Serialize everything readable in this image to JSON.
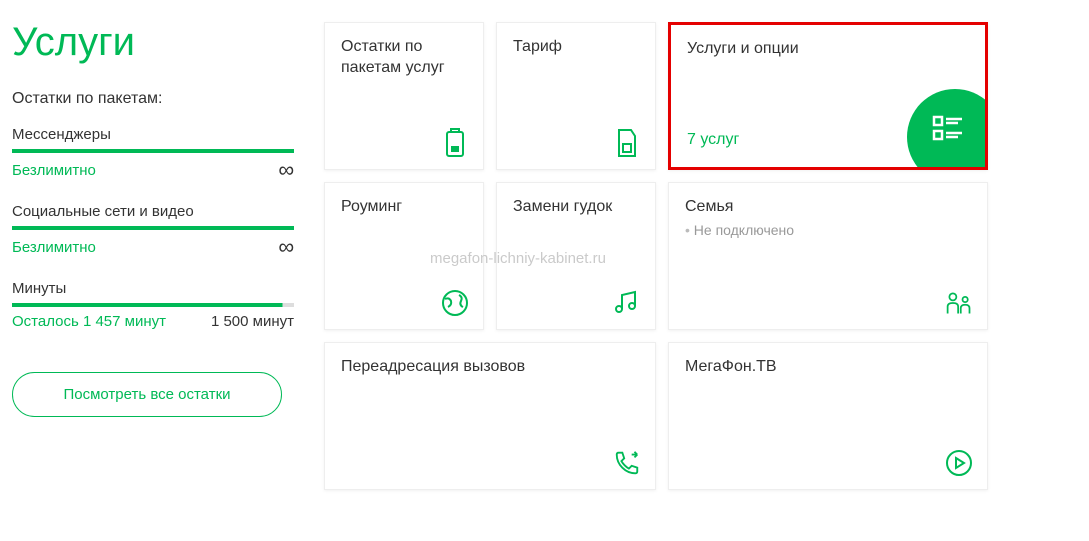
{
  "page": {
    "title": "Услуги",
    "balances_heading": "Остатки по пакетам:"
  },
  "watermark": "megafon-lichniy-kabinet.ru",
  "balances": [
    {
      "label": "Мессенджеры",
      "value": "Безлимитно",
      "infinity": "∞"
    },
    {
      "label": "Социальные сети и видео",
      "value": "Безлимитно",
      "infinity": "∞"
    },
    {
      "label": "Минуты",
      "value": "Осталось 1 457 минут",
      "total": "1 500 минут"
    }
  ],
  "view_all": "Посмотреть все остатки",
  "cards": {
    "packages": {
      "title": "Остатки по пакетам услуг"
    },
    "tariff": {
      "title": "Тариф"
    },
    "services": {
      "title": "Услуги и опции",
      "count": "7 услуг"
    },
    "roaming": {
      "title": "Роуминг"
    },
    "ringback": {
      "title": "Замени гудок"
    },
    "family": {
      "title": "Семья",
      "sub": "Не подключено"
    },
    "forwarding": {
      "title": "Переадресация вызовов"
    },
    "tv": {
      "title": "МегаФон.ТВ"
    }
  }
}
